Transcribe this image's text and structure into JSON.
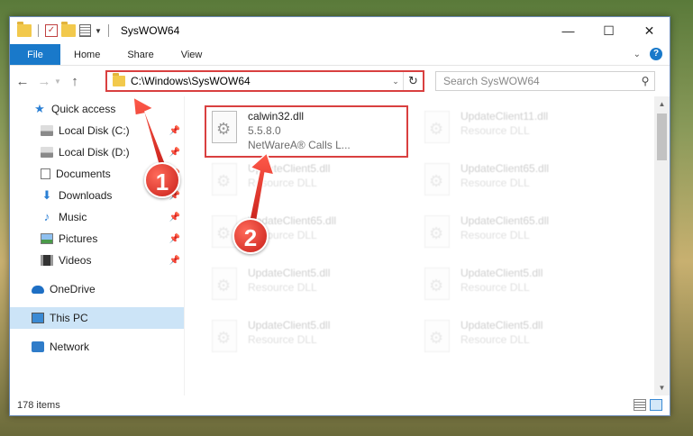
{
  "window": {
    "title": "SysWOW64",
    "controls": {
      "minimize": "—",
      "maximize": "☐",
      "close": "✕"
    }
  },
  "ribbon": {
    "tabs": [
      "File",
      "Home",
      "Share",
      "View"
    ],
    "help": "?"
  },
  "address": {
    "path": "C:\\Windows\\SysWOW64",
    "search_placeholder": "Search SysWOW64"
  },
  "sidebar": {
    "items": [
      {
        "label": "Quick access",
        "icon": "star-icon",
        "pinned": false
      },
      {
        "label": "Local Disk (C:)",
        "icon": "drive-icon",
        "pinned": true
      },
      {
        "label": "Local Disk (D:)",
        "icon": "drive-icon",
        "pinned": true
      },
      {
        "label": "Documents",
        "icon": "documents-icon",
        "pinned": true
      },
      {
        "label": "Downloads",
        "icon": "downloads-icon",
        "pinned": true
      },
      {
        "label": "Music",
        "icon": "music-icon",
        "pinned": true
      },
      {
        "label": "Pictures",
        "icon": "pictures-icon",
        "pinned": true
      },
      {
        "label": "Videos",
        "icon": "videos-icon",
        "pinned": true
      },
      {
        "label": "OneDrive",
        "icon": "onedrive-icon",
        "pinned": false
      },
      {
        "label": "This PC",
        "icon": "pc-icon",
        "pinned": false,
        "selected": true
      },
      {
        "label": "Network",
        "icon": "network-icon",
        "pinned": false
      }
    ]
  },
  "files": [
    {
      "name": "calwin32.dll",
      "line2": "5.5.8.0",
      "line3": "NetWareA® Calls L...",
      "highlighted": true
    },
    {
      "name": "UpdateClient11.dll",
      "line2": "Resource DLL"
    },
    {
      "name": "UpdateClient5.dll",
      "line2": "Resource DLL"
    },
    {
      "name": "UpdateClient65.dll",
      "line2": "Resource DLL"
    },
    {
      "name": "UpdateClient65.dll",
      "line2": "Resource DLL"
    },
    {
      "name": "UpdateClient65.dll",
      "line2": "Resource DLL"
    },
    {
      "name": "UpdateClient5.dll",
      "line2": "Resource DLL"
    },
    {
      "name": "UpdateClient5.dll",
      "line2": "Resource DLL"
    },
    {
      "name": "UpdateClient5.dll",
      "line2": "Resource DLL"
    },
    {
      "name": "UpdateClient5.dll",
      "line2": "Resource DLL"
    }
  ],
  "status": {
    "count": "178 items"
  },
  "callouts": {
    "one": "1",
    "two": "2"
  },
  "colors": {
    "accent": "#1979ca",
    "highlight": "#d94040",
    "selected": "#cce4f7"
  }
}
